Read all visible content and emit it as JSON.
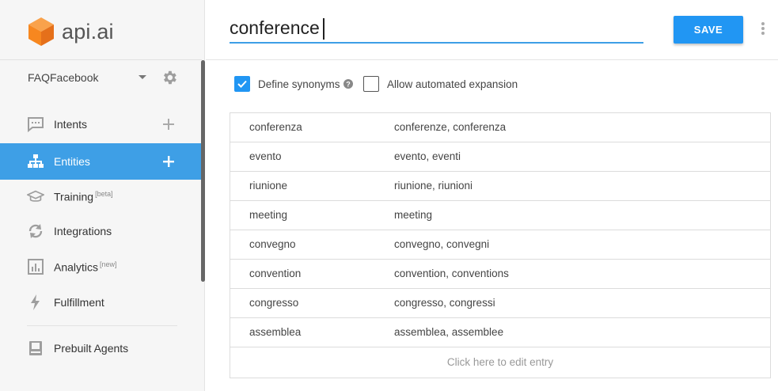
{
  "brand": {
    "logo_text": "api.ai",
    "accent": "#f7871f"
  },
  "sidebar": {
    "agent_name": "FAQFacebook",
    "items": [
      {
        "label": "Intents",
        "sup": ""
      },
      {
        "label": "Entities",
        "sup": ""
      },
      {
        "label": "Training",
        "sup": "[beta]"
      },
      {
        "label": "Integrations",
        "sup": ""
      },
      {
        "label": "Analytics",
        "sup": "[new]"
      },
      {
        "label": "Fulfillment",
        "sup": ""
      },
      {
        "label": "Prebuilt Agents",
        "sup": ""
      }
    ],
    "active_color": "#3e9fe6"
  },
  "header": {
    "entity_name": "conference",
    "save_label": "SAVE"
  },
  "options": {
    "define_synonyms_label": "Define synonyms",
    "define_synonyms_checked": true,
    "allow_expansion_label": "Allow automated expansion",
    "allow_expansion_checked": false
  },
  "entries": [
    {
      "value": "conferenza",
      "synonyms": "conferenze, conferenza"
    },
    {
      "value": "evento",
      "synonyms": "evento, eventi"
    },
    {
      "value": "riunione",
      "synonyms": "riunione, riunioni"
    },
    {
      "value": "meeting",
      "synonyms": "meeting"
    },
    {
      "value": "convegno",
      "synonyms": "convegno, convegni"
    },
    {
      "value": "convention",
      "synonyms": "convention, conventions"
    },
    {
      "value": "congresso",
      "synonyms": "congresso, congressi"
    },
    {
      "value": "assemblea",
      "synonyms": "assemblea, assemblee"
    }
  ],
  "edit_entry_label": "Click here to edit entry"
}
